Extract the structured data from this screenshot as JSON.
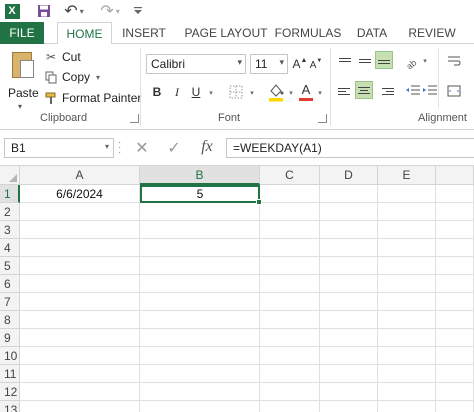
{
  "quick_access": {
    "app_icon_letter": "X",
    "undo_glyph": "↶",
    "redo_glyph": "↷",
    "dropdown_glyph": "▾"
  },
  "tabs": [
    {
      "label": "FILE"
    },
    {
      "label": "HOME"
    },
    {
      "label": "INSERT"
    },
    {
      "label": "PAGE LAYOUT"
    },
    {
      "label": "FORMULAS"
    },
    {
      "label": "DATA"
    },
    {
      "label": "REVIEW"
    }
  ],
  "clipboard": {
    "paste_label": "Paste",
    "cut_label": "Cut",
    "copy_label": "Copy",
    "format_painter_label": "Format Painter",
    "group_label": "Clipboard"
  },
  "font": {
    "name": "Calibri",
    "size": "11",
    "bold": "B",
    "italic": "I",
    "underline": "U",
    "font_color_letter": "A",
    "grow_letter": "A",
    "shrink_letter": "A",
    "group_label": "Font"
  },
  "alignment": {
    "group_label": "Alignment"
  },
  "formula_bar": {
    "name_box": "B1",
    "cancel_glyph": "✕",
    "enter_glyph": "✓",
    "fx": "fx",
    "formula": "=WEEKDAY(A1)"
  },
  "sheet": {
    "columns": [
      "A",
      "B",
      "C",
      "D",
      "E"
    ],
    "rows": [
      "1",
      "2",
      "3",
      "4",
      "5",
      "6",
      "7",
      "8",
      "9",
      "10",
      "11",
      "12",
      "13"
    ],
    "cells": {
      "A1": "6/6/2024",
      "B1": "5"
    },
    "active_cell": "B1"
  },
  "colors": {
    "accent": "#217346",
    "selected_button": "#c6e0b4",
    "font_color_bar": "#e03c31",
    "fill_color_bar": "#ffd700"
  }
}
